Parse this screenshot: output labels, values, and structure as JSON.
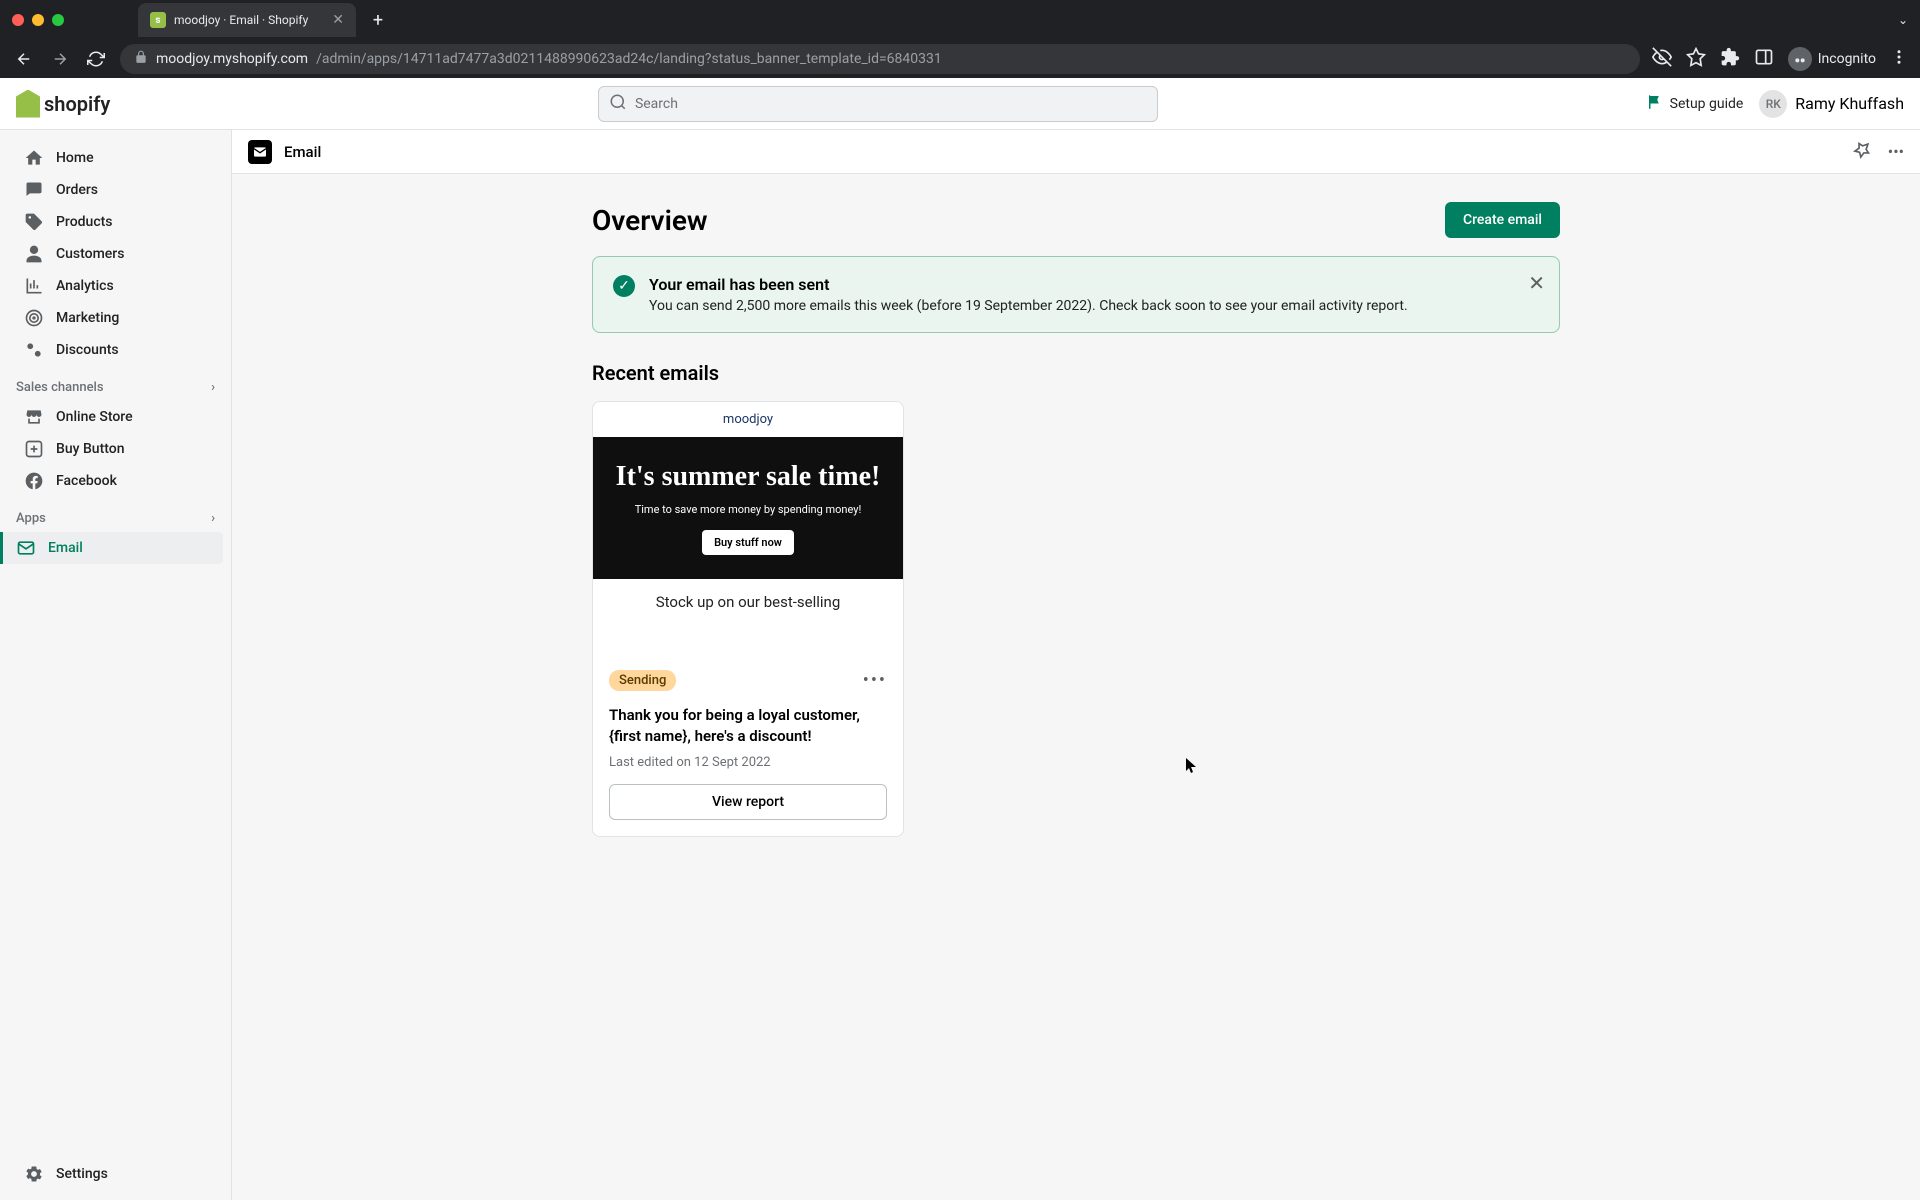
{
  "browser": {
    "tab_title": "moodjoy · Email · Shopify",
    "url_host": "moodjoy.myshopify.com",
    "url_path": "/admin/apps/14711ad7477a3d0211488990623ad24c/landing?status_banner_template_id=6840331",
    "incognito_label": "Incognito"
  },
  "topbar": {
    "logo_text": "shopify",
    "search_placeholder": "Search",
    "setup_guide": "Setup guide",
    "user_initials": "RK",
    "user_name": "Ramy Khuffash"
  },
  "sidebar": {
    "items": [
      {
        "label": "Home"
      },
      {
        "label": "Orders"
      },
      {
        "label": "Products"
      },
      {
        "label": "Customers"
      },
      {
        "label": "Analytics"
      },
      {
        "label": "Marketing"
      },
      {
        "label": "Discounts"
      }
    ],
    "sales_channels_header": "Sales channels",
    "channels": [
      {
        "label": "Online Store"
      },
      {
        "label": "Buy Button"
      },
      {
        "label": "Facebook"
      }
    ],
    "apps_header": "Apps",
    "apps": [
      {
        "label": "Email"
      }
    ],
    "settings": "Settings"
  },
  "page": {
    "app_name": "Email",
    "title": "Overview",
    "create_button": "Create email"
  },
  "banner": {
    "title": "Your email has been sent",
    "text": "You can send 2,500 more emails this week (before 19 September 2022). Check back soon to see your email activity report."
  },
  "recent": {
    "title": "Recent emails",
    "card": {
      "brand": "moodjoy",
      "headline": "It's summer sale time!",
      "subhead": "Time to save more money by spending money!",
      "cta": "Buy stuff now",
      "tagline": "Stock up on our best-selling",
      "status": "Sending",
      "subject": "Thank you for being a loyal customer, {first name}, here's a discount!",
      "meta": "Last edited on 12 Sept 2022",
      "view_report": "View report"
    }
  }
}
